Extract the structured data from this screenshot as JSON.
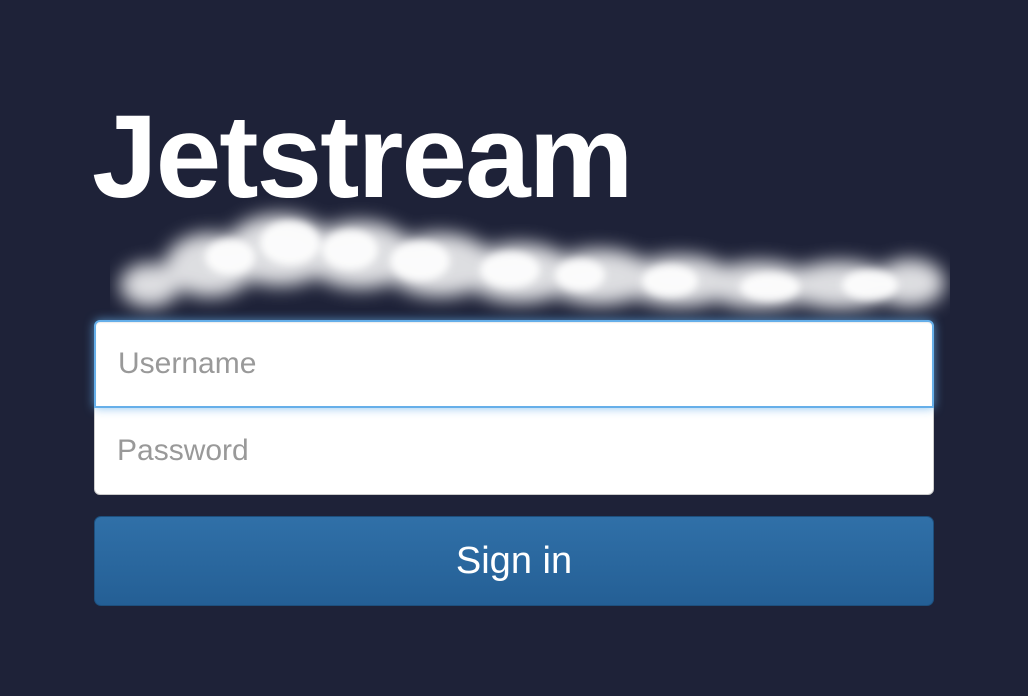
{
  "brand": {
    "title": "Jetstream"
  },
  "login": {
    "username_placeholder": "Username",
    "password_placeholder": "Password",
    "signin_label": "Sign in"
  },
  "colors": {
    "background": "#1e2238",
    "button": "#2b6aa3",
    "focus_glow": "#66afe9",
    "title": "#ffffff"
  },
  "icons": {
    "smoke_trail": "smoke-trail-icon"
  }
}
